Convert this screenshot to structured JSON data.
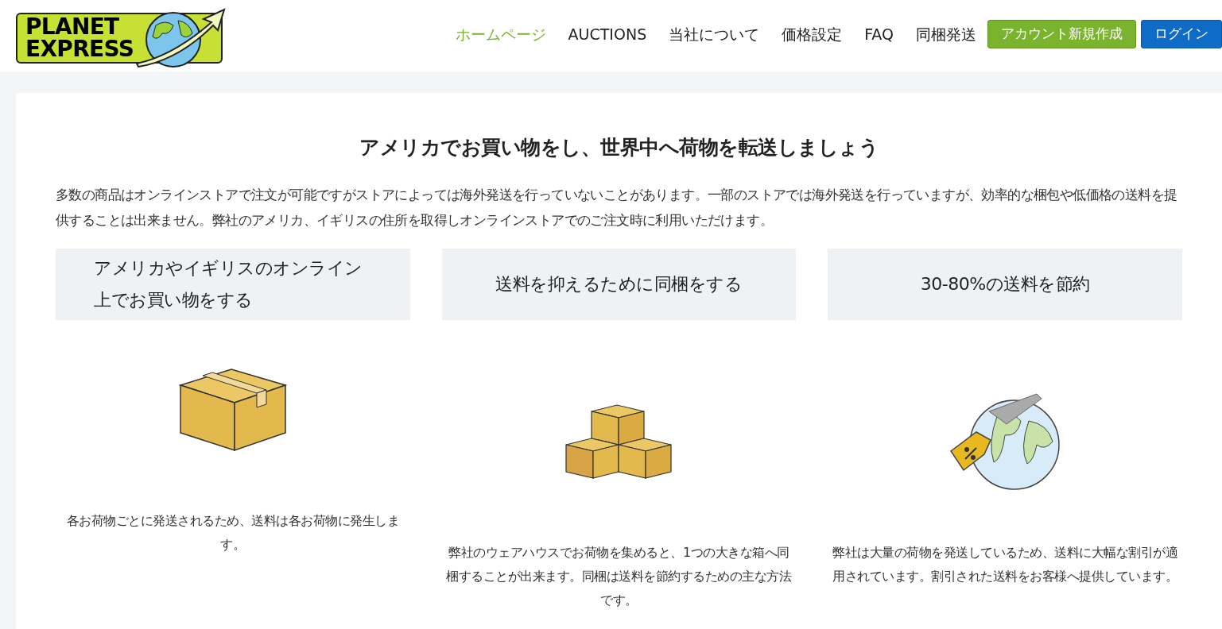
{
  "logo": {
    "line1": "PLANET",
    "line2": "EXPRESS"
  },
  "nav": [
    {
      "label": "ホームページ",
      "selected": true
    },
    {
      "label": "AUCTIONS",
      "selected": false
    },
    {
      "label": "当社について",
      "selected": false
    },
    {
      "label": "価格設定",
      "selected": false
    },
    {
      "label": "FAQ",
      "selected": false
    },
    {
      "label": "同梱発送",
      "selected": false
    }
  ],
  "buttons": [
    {
      "label": "アカウント新規作成",
      "kind": "signup"
    },
    {
      "label": "ログイン",
      "kind": "login"
    }
  ],
  "heading": "アメリカでお買い物をし、世界中へ荷物を転送しましょう",
  "intro": "多数の商品はオンラインストアで注文が可能ですがストアによっては海外発送を行っていないことがあります。一部のストアでは海外発送を行っていますが、効率的な梱包や低価格の送料を提供することは出来ません。弊社のアメリカ、イギリスの住所を取得しオンラインストアでのご注文時に利用いただけます。",
  "features": [
    {
      "title": "アメリカやイギリスのオンライン上でお買い物をする",
      "kind": "box",
      "text": "各お荷物ごとに発送されるため、送料は各お荷物に発生します。"
    },
    {
      "title": "送料を抑えるために同梱をする",
      "kind": "boxes",
      "text": "弊社のウェアハウスでお荷物を集めると、1つの大きな箱へ同梱することが出来ます。同梱は送料を節約するための主な方法です。"
    },
    {
      "title": "30-80%の送料を節約",
      "kind": "globe",
      "text": "弊社は大量の荷物を発送しているため、送料に大幅な割引が適用されています。割引された送料をお客様へ提供しています。"
    }
  ]
}
